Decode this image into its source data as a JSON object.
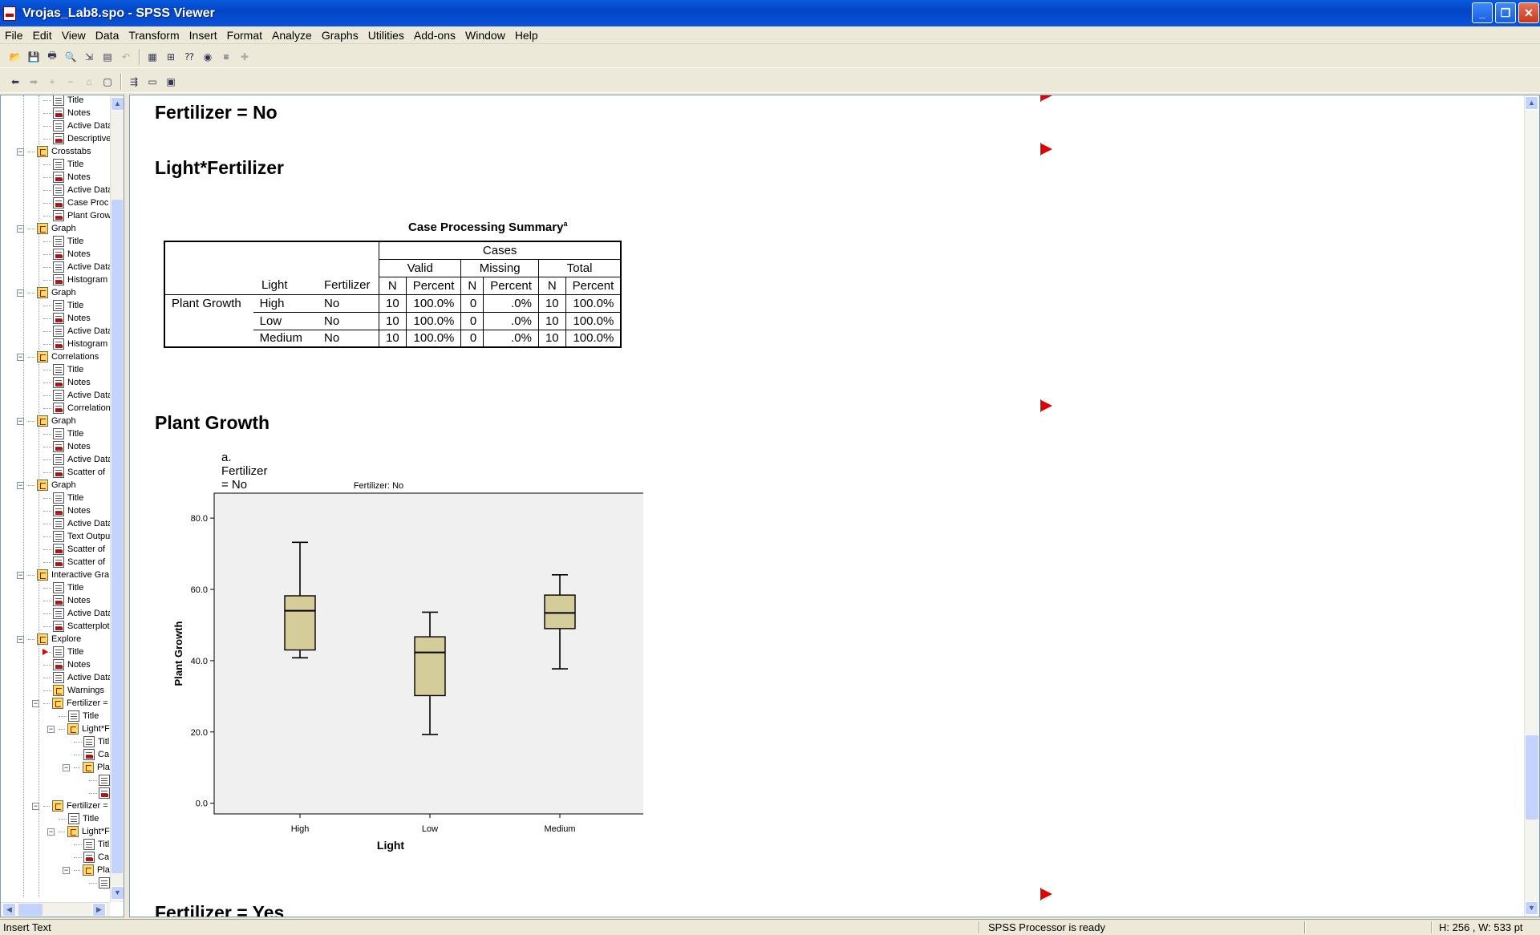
{
  "window": {
    "title": "Vrojas_Lab8.spo - SPSS Viewer"
  },
  "menu": [
    "File",
    "Edit",
    "View",
    "Data",
    "Transform",
    "Insert",
    "Format",
    "Analyze",
    "Graphs",
    "Utilities",
    "Add-ons",
    "Window",
    "Help"
  ],
  "outline": [
    {
      "label": "Title",
      "icon": "page-icon"
    },
    {
      "label": "Notes",
      "icon": "notes-icon"
    },
    {
      "label": "Active Data",
      "icon": "page-icon"
    },
    {
      "label": "Descriptive",
      "icon": "table-icon"
    },
    {
      "label": "Crosstabs",
      "icon": "book-icon"
    },
    {
      "label": "Title",
      "icon": "page-icon"
    },
    {
      "label": "Notes",
      "icon": "notes-icon"
    },
    {
      "label": "Active Data",
      "icon": "page-icon"
    },
    {
      "label": "Case Proc",
      "icon": "table-icon"
    },
    {
      "label": "Plant Grow",
      "icon": "table-icon"
    },
    {
      "label": "Graph",
      "icon": "book-icon"
    },
    {
      "label": "Title",
      "icon": "page-icon"
    },
    {
      "label": "Notes",
      "icon": "notes-icon"
    },
    {
      "label": "Active Data",
      "icon": "page-icon"
    },
    {
      "label": "Histogram",
      "icon": "chart-icon"
    },
    {
      "label": "Graph",
      "icon": "book-icon"
    },
    {
      "label": "Title",
      "icon": "page-icon"
    },
    {
      "label": "Notes",
      "icon": "notes-icon"
    },
    {
      "label": "Active Data",
      "icon": "page-icon"
    },
    {
      "label": "Histogram",
      "icon": "chart-icon"
    },
    {
      "label": "Correlations",
      "icon": "book-icon"
    },
    {
      "label": "Title",
      "icon": "page-icon"
    },
    {
      "label": "Notes",
      "icon": "notes-icon"
    },
    {
      "label": "Active Data",
      "icon": "page-icon"
    },
    {
      "label": "Correlation",
      "icon": "table-icon"
    },
    {
      "label": "Graph",
      "icon": "book-icon"
    },
    {
      "label": "Title",
      "icon": "page-icon"
    },
    {
      "label": "Notes",
      "icon": "notes-icon"
    },
    {
      "label": "Active Data",
      "icon": "page-icon"
    },
    {
      "label": "Scatter of",
      "icon": "chart-icon"
    },
    {
      "label": "Graph",
      "icon": "book-icon"
    },
    {
      "label": "Title",
      "icon": "page-icon"
    },
    {
      "label": "Notes",
      "icon": "notes-icon"
    },
    {
      "label": "Active Data",
      "icon": "page-icon"
    },
    {
      "label": "Text Output",
      "icon": "page-icon"
    },
    {
      "label": "Scatter of",
      "icon": "chart-icon"
    },
    {
      "label": "Scatter of",
      "icon": "chart-icon"
    },
    {
      "label": "Interactive Gra",
      "icon": "book-icon"
    },
    {
      "label": "Title",
      "icon": "page-icon"
    },
    {
      "label": "Notes",
      "icon": "notes-icon"
    },
    {
      "label": "Active Data",
      "icon": "page-icon"
    },
    {
      "label": "Scatterplot",
      "icon": "chart-icon"
    },
    {
      "label": "Explore",
      "icon": "book-icon"
    },
    {
      "label": "Title",
      "icon": "page-icon"
    },
    {
      "label": "Notes",
      "icon": "notes-icon"
    },
    {
      "label": "Active Data",
      "icon": "page-icon"
    },
    {
      "label": "Warnings",
      "icon": "warning-icon"
    },
    {
      "label": "Fertilizer =",
      "icon": "book-icon"
    },
    {
      "label": "Title",
      "icon": "page-icon"
    },
    {
      "label": "Light*F",
      "icon": "book-icon"
    },
    {
      "label": "Titl",
      "icon": "page-icon"
    },
    {
      "label": "Ca",
      "icon": "table-icon"
    },
    {
      "label": "Pla",
      "icon": "book-icon"
    },
    {
      "label": "",
      "icon": "page-icon"
    },
    {
      "label": "",
      "icon": "chart-icon"
    },
    {
      "label": "Fertilizer =",
      "icon": "book-icon"
    },
    {
      "label": "Title",
      "icon": "page-icon"
    },
    {
      "label": "Light*F",
      "icon": "book-icon"
    },
    {
      "label": "Titl",
      "icon": "page-icon"
    },
    {
      "label": "Ca",
      "icon": "table-icon"
    },
    {
      "label": "Pla",
      "icon": "book-icon"
    },
    {
      "label": "",
      "icon": "page-icon"
    }
  ],
  "viewer": {
    "heading1": "Fertilizer = No",
    "heading2": "Light*Fertilizer",
    "heading3": "Plant Growth",
    "heading4": "Fertilizer = Yes",
    "table": {
      "title": "Case Processing Summary",
      "title_sup": "a",
      "cases": "Cases",
      "groups": [
        "Valid",
        "Missing",
        "Total"
      ],
      "col_light": "Light",
      "col_fertilizer": "Fertilizer",
      "sub": [
        "N",
        "Percent",
        "N",
        "Percent",
        "N",
        "Percent"
      ],
      "row_label": "Plant Growth",
      "rows": [
        [
          "High",
          "No",
          "10",
          "100.0%",
          "0",
          ".0%",
          "10",
          "100.0%"
        ],
        [
          "Low",
          "No",
          "10",
          "100.0%",
          "0",
          ".0%",
          "10",
          "100.0%"
        ],
        [
          "Medium",
          "No",
          "10",
          "100.0%",
          "0",
          ".0%",
          "10",
          "100.0%"
        ]
      ],
      "footnote": "a. Fertilizer = No"
    }
  },
  "chart_data": {
    "type": "boxplot",
    "title": "Fertilizer: No",
    "xlabel": "Light",
    "ylabel": "Plant Growth",
    "ylim": [
      -3,
      87
    ],
    "yticks": [
      "0.0",
      "20.0",
      "40.0",
      "60.0",
      "80.0"
    ],
    "categories": [
      "High",
      "Low",
      "Medium"
    ],
    "boxes": [
      {
        "min": 40.8,
        "q1": 43.0,
        "median": 54.0,
        "q3": 58.2,
        "max": 73.2
      },
      {
        "min": 19.3,
        "q1": 30.2,
        "median": 42.3,
        "q3": 46.7,
        "max": 53.6
      },
      {
        "min": 37.7,
        "q1": 49.0,
        "median": 53.4,
        "q3": 58.4,
        "max": 64.1
      }
    ],
    "box_color": "#d4cc99",
    "plot_bg": "#f0f0f0"
  },
  "status": {
    "left": "Insert Text",
    "middle": "SPSS Processor  is ready",
    "right": "H: 256 , W: 533 pt"
  }
}
